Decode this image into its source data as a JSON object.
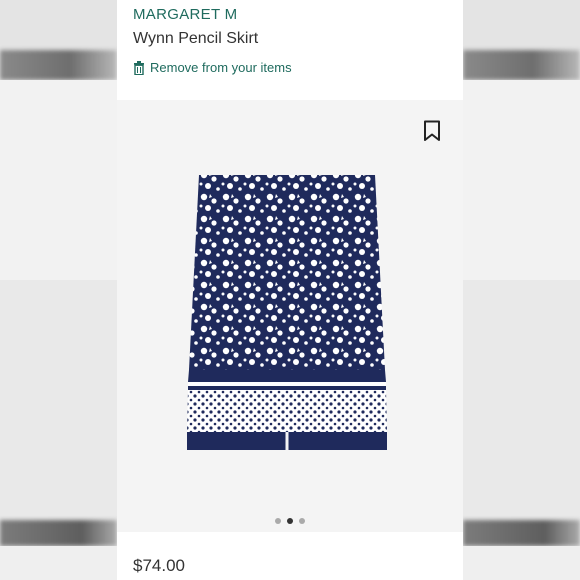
{
  "product": {
    "brand": "MARGARET M",
    "name": "Wynn Pencil Skirt",
    "remove_label": "Remove from your items",
    "price": "$74.00"
  },
  "gallery": {
    "image_count": 3,
    "active_index": 1
  },
  "icons": {
    "remove": "trash-icon",
    "save": "bookmark-icon"
  },
  "colors": {
    "brand_green": "#1f6b5e",
    "navy": "#1f2a5c"
  }
}
